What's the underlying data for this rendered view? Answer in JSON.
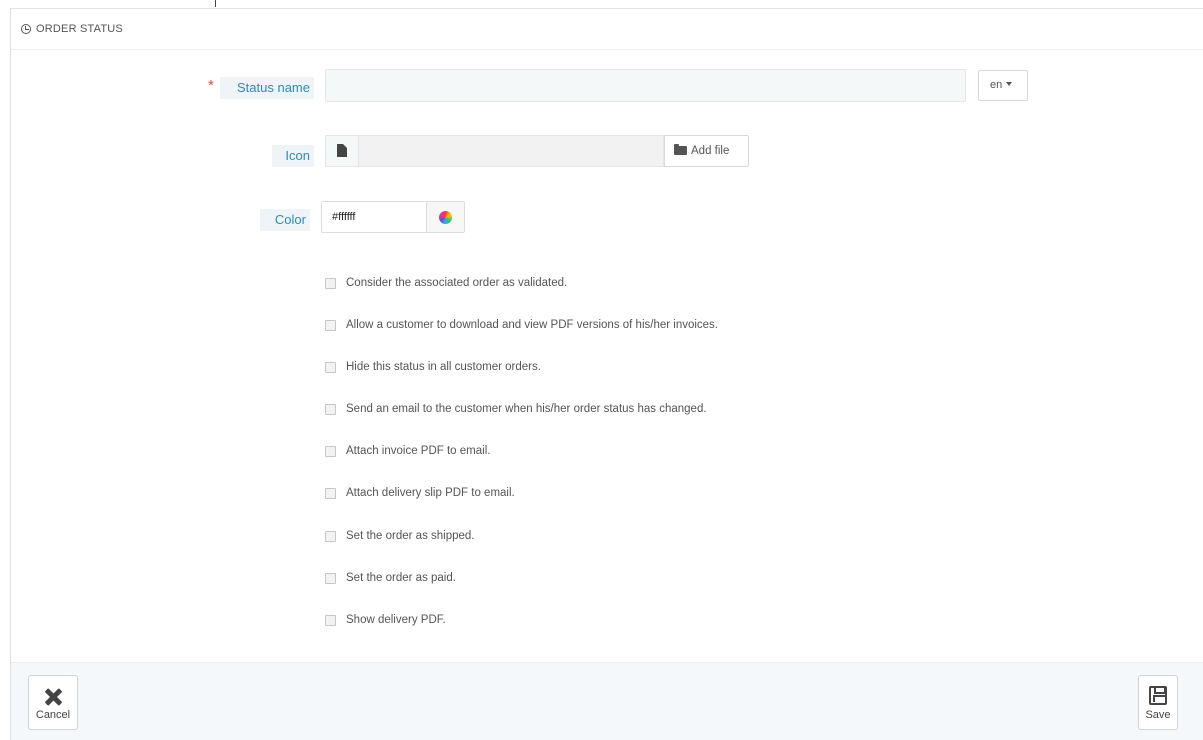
{
  "panel": {
    "title": "ORDER STATUS"
  },
  "form": {
    "status_name": {
      "label": "Status name",
      "required_marker": "*",
      "value": "",
      "language": "en"
    },
    "icon": {
      "label": "Icon",
      "file_name": "",
      "add_file_label": "Add file"
    },
    "color": {
      "label": "Color",
      "value": "#ffffff"
    },
    "options": [
      {
        "label": "Consider the associated order as validated.",
        "checked": false
      },
      {
        "label": "Allow a customer to download and view PDF versions of his/her invoices.",
        "checked": false
      },
      {
        "label": "Hide this status in all customer orders.",
        "checked": false
      },
      {
        "label": "Send an email to the customer when his/her order status has changed.",
        "checked": false
      },
      {
        "label": "Attach invoice PDF to email.",
        "checked": false
      },
      {
        "label": "Attach delivery slip PDF to email.",
        "checked": false
      },
      {
        "label": "Set the order as shipped.",
        "checked": false
      },
      {
        "label": "Set the order as paid.",
        "checked": false
      },
      {
        "label": "Show delivery PDF.",
        "checked": false
      }
    ]
  },
  "footer": {
    "cancel_label": "Cancel",
    "save_label": "Save"
  },
  "icons": {
    "heading": "clock-check-icon",
    "file": "document-icon",
    "add_file": "folder-open-icon",
    "color": "color-wheel-icon",
    "cancel": "close-icon",
    "save": "floppy-disk-icon"
  },
  "colors": {
    "label_text": "#2a8dbd",
    "required": "#e04b3b",
    "footer_bg": "#f4f8fb"
  }
}
